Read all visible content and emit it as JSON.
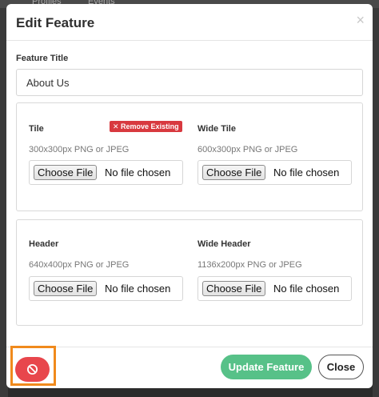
{
  "background": {
    "nav_items": [
      "Profiles",
      "Events"
    ]
  },
  "modal": {
    "title": "Edit Feature",
    "close_icon": "×"
  },
  "form": {
    "title_label": "Feature Title",
    "title_value": "About Us"
  },
  "images": [
    {
      "label": "Tile",
      "hint": "300x300px PNG or JPEG",
      "button": "Choose File",
      "status": "No file chosen",
      "remove_label": "✕ Remove Existing"
    },
    {
      "label": "Wide Tile",
      "hint": "600x300px PNG or JPEG",
      "button": "Choose File",
      "status": "No file chosen"
    },
    {
      "label": "Header",
      "hint": "640x400px PNG or JPEG",
      "button": "Choose File",
      "status": "No file chosen"
    },
    {
      "label": "Wide Header",
      "hint": "1136x200px PNG or JPEG",
      "button": "Choose File",
      "status": "No file chosen"
    }
  ],
  "footer": {
    "delete_icon": "ban-icon",
    "update_label": "Update Feature",
    "close_label": "Close"
  },
  "colors": {
    "delete": "#e8464c",
    "update": "#57c188",
    "remove_badge": "#d8393f",
    "highlight": "#f08a1c"
  }
}
